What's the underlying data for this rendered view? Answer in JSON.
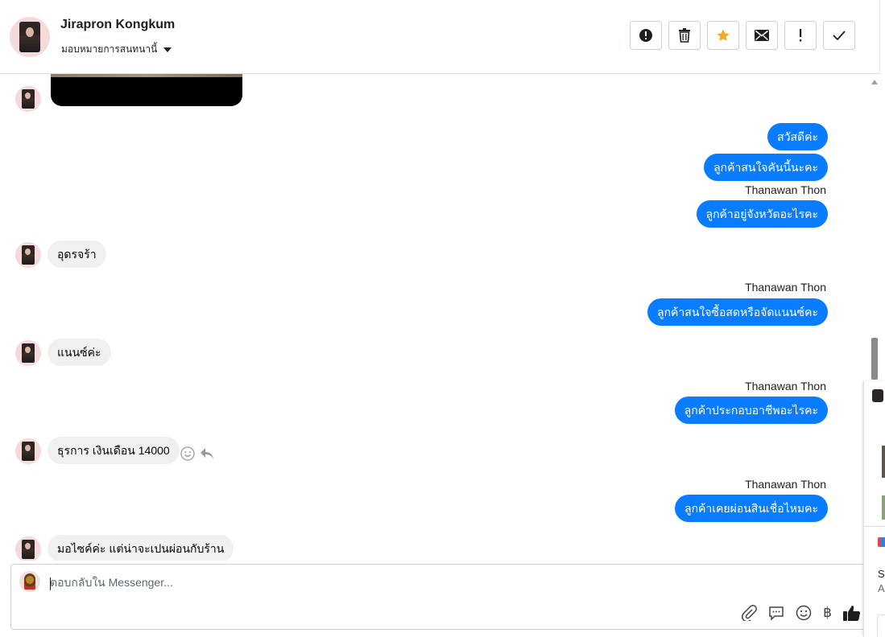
{
  "header": {
    "contact_name": "Jirapron Kongkum",
    "assign_label": "มอบหมายการสนทนานี้"
  },
  "toolbar": {
    "buttons": [
      "alert-icon",
      "trash-icon",
      "star-icon",
      "envelope-icon",
      "exclamation-icon",
      "check-icon"
    ],
    "star_color": "#f5a623"
  },
  "messages": [
    {
      "direction": "in",
      "type": "media"
    },
    {
      "direction": "out",
      "text": "สวัสดีค่ะ"
    },
    {
      "direction": "out",
      "text": "ลูกค้าสนใจคันนี้นะคะ"
    },
    {
      "direction": "out",
      "sender": "Thanawan Thon",
      "text": "ลูกค้าอยู่จังหวัดอะไรคะ"
    },
    {
      "direction": "in",
      "text": "อุดรจร้า"
    },
    {
      "direction": "out",
      "sender": "Thanawan Thon",
      "text": "ลูกค้าสนใจซื้อสดหรือจัดแนนซ์คะ"
    },
    {
      "direction": "in",
      "text": "แนนซ์ค่ะ"
    },
    {
      "direction": "out",
      "sender": "Thanawan Thon",
      "text": "ลูกค้าประกอบอาชีพอะไรคะ"
    },
    {
      "direction": "in",
      "text": "ธุรการ เงินเดือน 14000"
    },
    {
      "direction": "out",
      "sender": "Thanawan Thon",
      "text": "ลูกค้าเคยผ่อนสินเชื่อไหมคะ"
    },
    {
      "direction": "in",
      "text": "มอไซค์ค่ะ แต่น่าจะเปนผ่อนกับร้าน"
    }
  ],
  "composer": {
    "placeholder": "ตอบกลับใน Messenger...",
    "tools": [
      "attach-icon",
      "saved-reply-icon",
      "emoji-icon",
      "baht-icon",
      "like-icon"
    ],
    "baht_symbol": "฿"
  },
  "side_panel": {
    "text_line1": "Sc",
    "text_line2": "A"
  },
  "colors": {
    "outgoing_bubble": "#0a7cff",
    "incoming_bubble": "#f0f0f0"
  }
}
